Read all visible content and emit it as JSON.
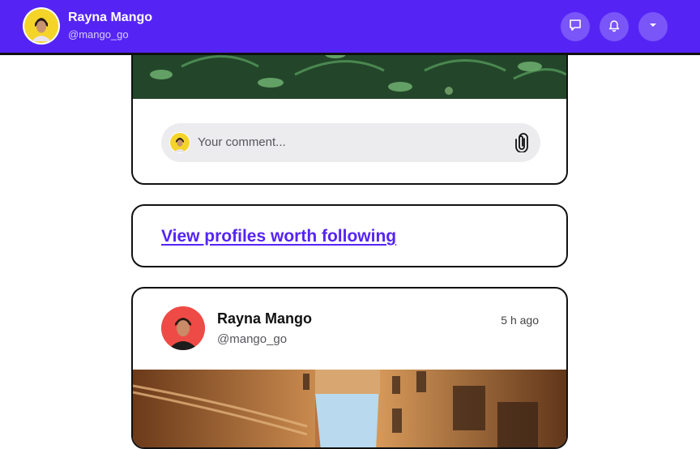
{
  "header": {
    "user_name": "Rayna Mango",
    "user_handle": "@mango_go",
    "buttons": [
      {
        "icon": "message-icon"
      },
      {
        "icon": "bell-icon"
      },
      {
        "icon": "caret-down-icon"
      }
    ],
    "accent_color": "#5524f5"
  },
  "feed": {
    "comment": {
      "placeholder": "Your comment...",
      "attach_icon": "paperclip-icon"
    },
    "suggest_link": "View profiles worth following",
    "post": {
      "author_name": "Rayna Mango",
      "author_handle": "@mango_go",
      "time_ago": "5 h ago"
    }
  }
}
